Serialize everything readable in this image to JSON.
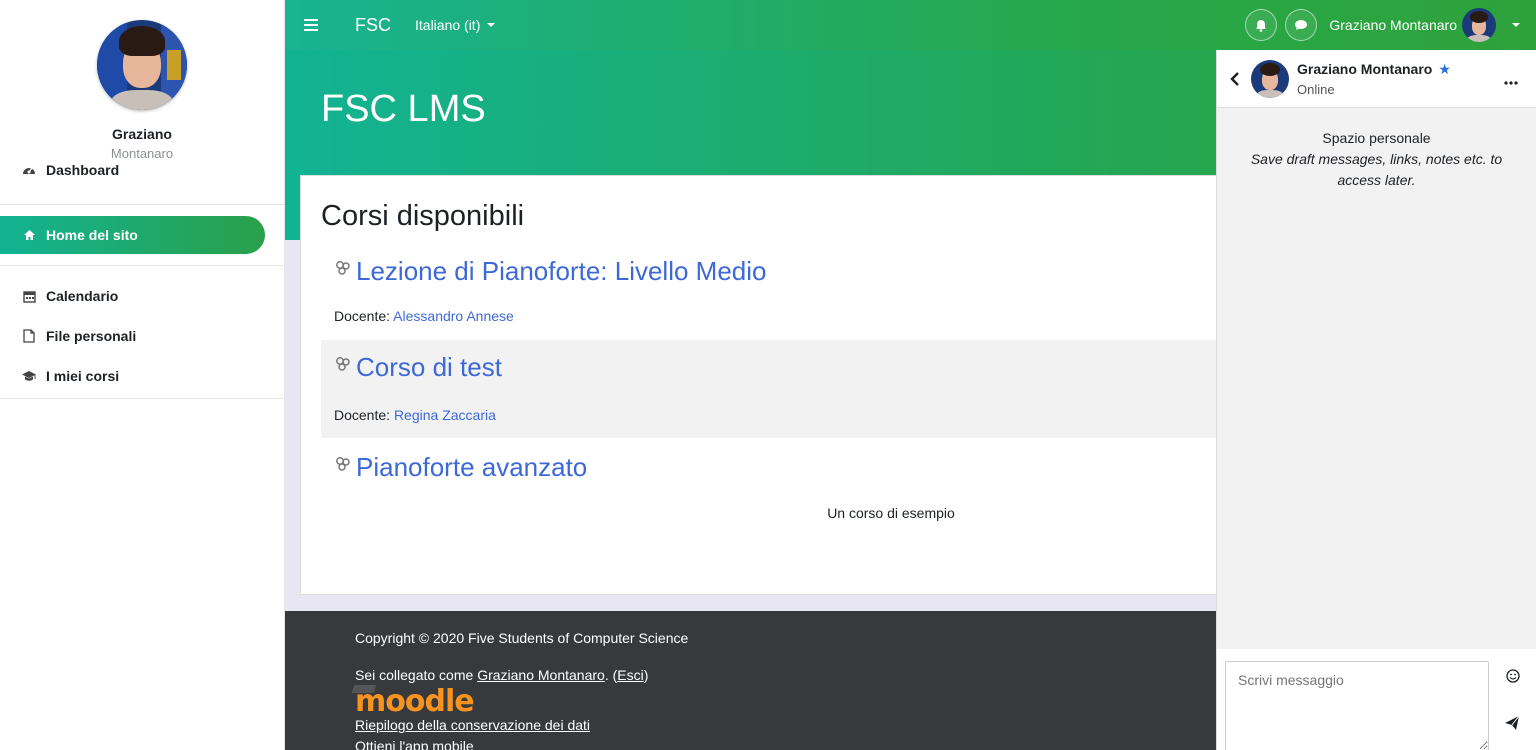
{
  "sidebar": {
    "user_first": "Graziano",
    "user_last": "Montanaro",
    "dashboard_label": "Dashboard",
    "home_label": "Home del sito",
    "items": [
      {
        "label": "Calendario"
      },
      {
        "label": "File personali"
      },
      {
        "label": "I miei corsi"
      }
    ]
  },
  "topbar": {
    "brand": "FSC",
    "language": "Italiano (it)",
    "user_name": "Graziano Montanaro"
  },
  "header": {
    "site_title": "FSC LMS"
  },
  "main": {
    "section_title": "Corsi disponibili",
    "courses": [
      {
        "name": "Lezione di Pianoforte: Livello Medio",
        "teacher_label": "Docente:",
        "teacher": "Alessandro Annese"
      },
      {
        "name": "Corso di test",
        "teacher_label": "Docente:",
        "teacher": "Regina Zaccaria"
      },
      {
        "name": "Pianoforte avanzato",
        "summary": "Un corso di esempio"
      }
    ]
  },
  "footer": {
    "copyright": "Copyright © 2020 Five Students of Computer Science",
    "logged_prefix": "Sei collegato come ",
    "logged_user": "Graziano Montanaro",
    "logout_open": ". (",
    "logout": "Esci",
    "logout_close": ")",
    "moodle_logo": "moodle",
    "data_retention": "Riepilogo della conservazione dei dati",
    "mobile_app": "Ottieni l'app mobile"
  },
  "messaging": {
    "contact_name": "Graziano Montanaro",
    "contact_status": "Online",
    "self_title": "Spazio personale",
    "self_desc": "Save draft messages, links, notes etc. to access later.",
    "input_placeholder": "Scrivi messaggio"
  },
  "colors": {
    "accent_green": "#18b390",
    "link_blue": "#3d69d8",
    "footer_dark": "#373a3c"
  }
}
